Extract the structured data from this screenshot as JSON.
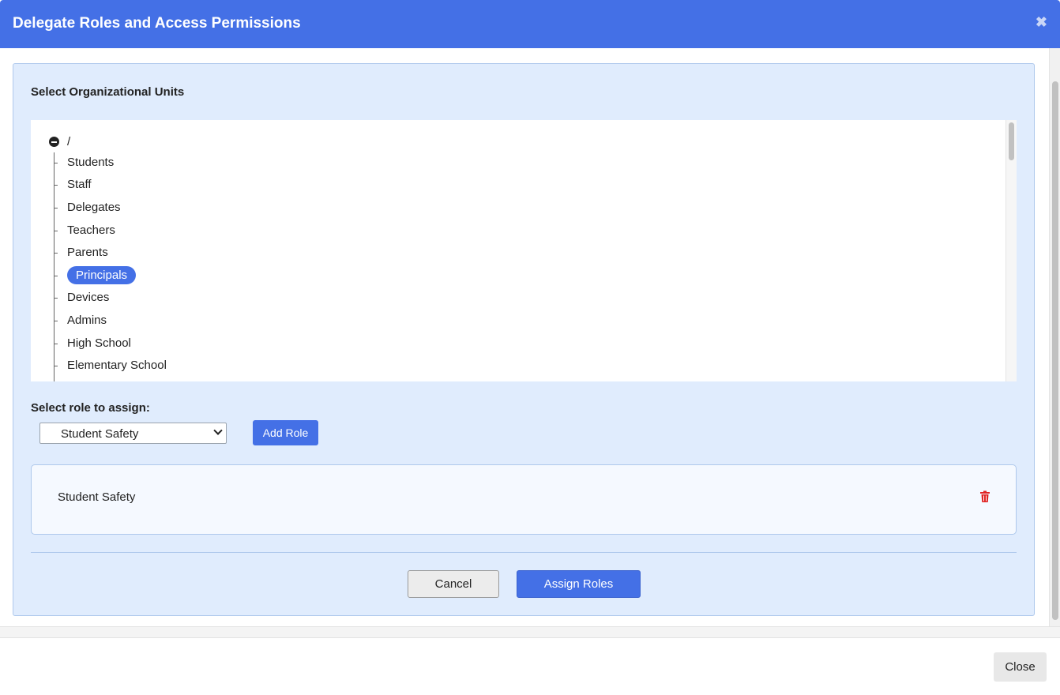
{
  "dialog": {
    "title": "Delegate Roles and Access Permissions",
    "close_icon": "close-icon"
  },
  "org_units": {
    "heading": "Select Organizational Units",
    "root_label": "/",
    "root_icon": "collapse-circle-icon",
    "items": [
      {
        "label": "Students",
        "selected": false
      },
      {
        "label": "Staff",
        "selected": false
      },
      {
        "label": "Delegates",
        "selected": false
      },
      {
        "label": "Teachers",
        "selected": false
      },
      {
        "label": "Parents",
        "selected": false
      },
      {
        "label": "Principals",
        "selected": true
      },
      {
        "label": "Devices",
        "selected": false
      },
      {
        "label": "Admins",
        "selected": false
      },
      {
        "label": "High School",
        "selected": false
      },
      {
        "label": "Elementary School",
        "selected": false
      }
    ]
  },
  "role": {
    "label": "Select role to assign:",
    "selected_value": "Student Safety",
    "add_button": "Add Role"
  },
  "assigned_roles": [
    {
      "label": "Student Safety",
      "delete_icon": "trash-icon"
    }
  ],
  "actions": {
    "cancel": "Cancel",
    "assign": "Assign Roles"
  },
  "footer": {
    "close": "Close"
  },
  "colors": {
    "accent": "#4470e6",
    "panel_bg": "#e0ecfd",
    "danger": "#e02424"
  }
}
